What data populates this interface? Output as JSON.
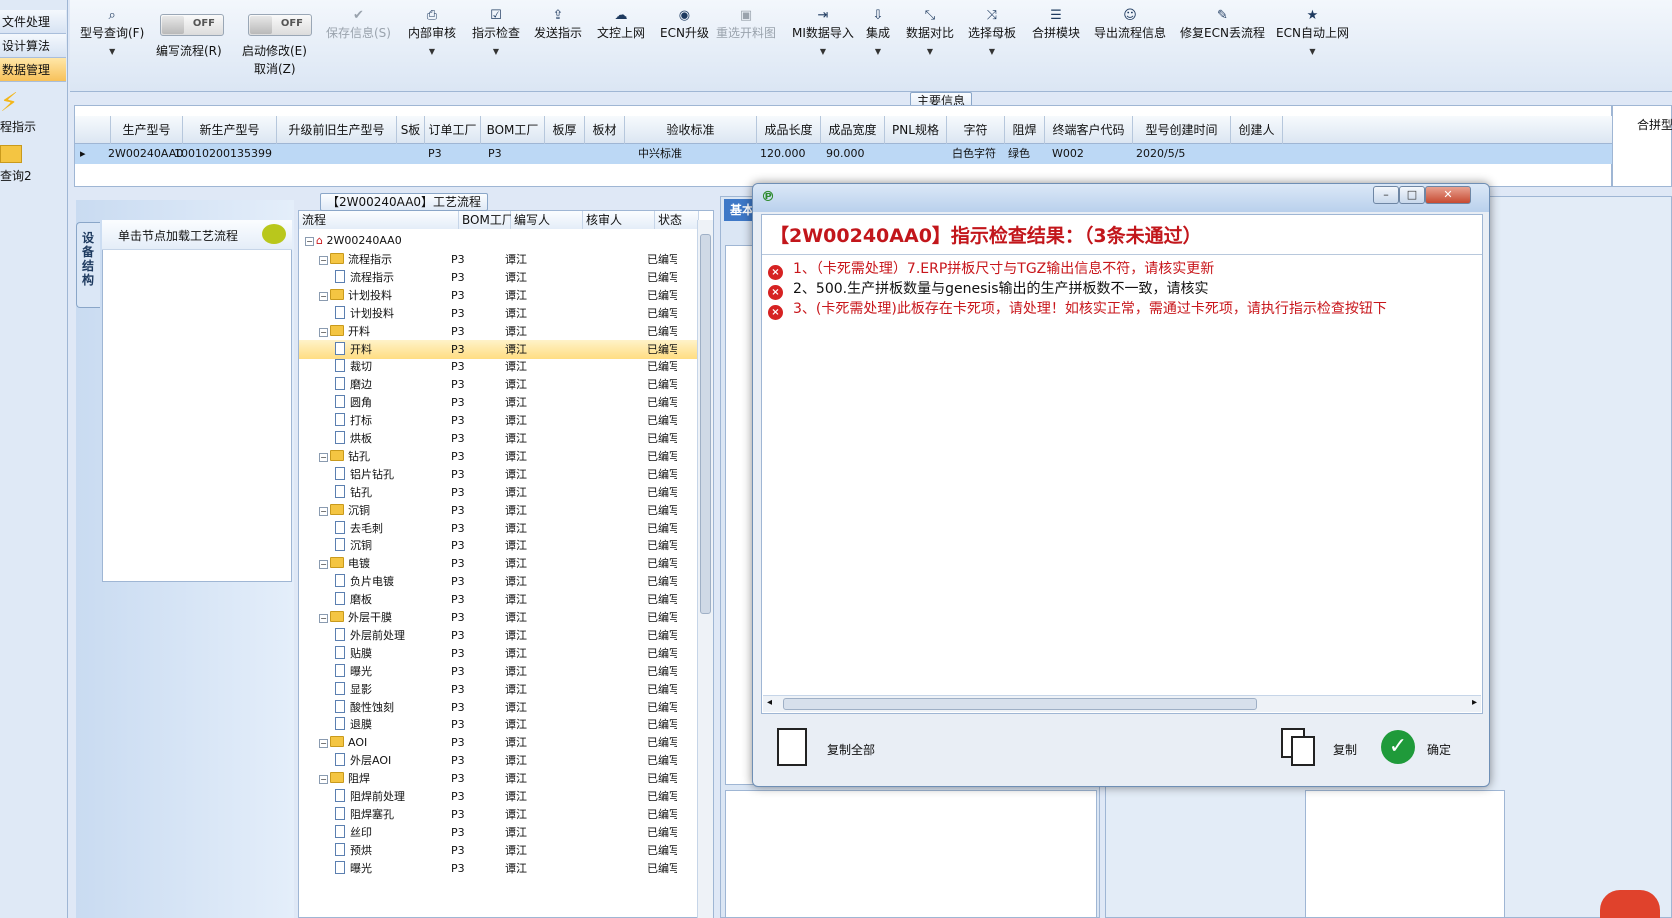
{
  "left_nav": {
    "items": [
      "文件处理",
      "设计算法",
      "数据管理"
    ],
    "big_items": [
      "程指示",
      "查询2"
    ]
  },
  "toolbar": {
    "buttons": [
      {
        "label": "型号查询(F)",
        "icon": "search-icon"
      },
      {
        "label": "保存信息(S)",
        "icon": "check-icon"
      },
      {
        "label": "内部审核",
        "icon": "printer-icon"
      },
      {
        "label": "指示检查",
        "icon": "checkbox-icon"
      },
      {
        "label": "发送指示",
        "icon": "upload-icon"
      },
      {
        "label": "文控上网",
        "icon": "cloud-upload-icon"
      },
      {
        "label": "ECN升级",
        "icon": "binoculars-icon"
      },
      {
        "label": "重选开料图",
        "icon": "image-icon"
      },
      {
        "label": "MI数据导入",
        "icon": "import-icon"
      },
      {
        "label": "集成",
        "icon": "download-icon"
      },
      {
        "label": "数据对比",
        "icon": "compress-icon"
      },
      {
        "label": "选择母板",
        "icon": "shuffle-icon"
      },
      {
        "label": "合拼模块",
        "icon": "list-icon"
      },
      {
        "label": "导出流程信息",
        "icon": "smile-icon"
      },
      {
        "label": "修复ECN丢流程",
        "icon": "wrench-icon"
      },
      {
        "label": "ECN自动上网",
        "icon": "star-icon"
      }
    ],
    "toggle1": {
      "state": "OFF",
      "label": "编写流程(R)"
    },
    "toggle2": {
      "state": "OFF",
      "label": "启动修改(E)",
      "label2": "取消(Z)"
    }
  },
  "main_info": {
    "title": "主要信息",
    "right_title": "合拼型",
    "columns": [
      "生产型号",
      "新生产型号",
      "升级前旧生产型号",
      "S板",
      "订单工厂",
      "BOM工厂",
      "板厚",
      "板材",
      "验收标准",
      "成品长度",
      "成品宽度",
      "PNL规格",
      "字符",
      "阻焊",
      "终端客户代码",
      "型号创建时间",
      "创建人"
    ],
    "row": [
      "2W00240AA0",
      "10010200135399",
      "",
      "",
      "P3",
      "P3",
      "",
      "",
      "中兴标准",
      "120.000",
      "90.000",
      "",
      "白色字符",
      "绿色",
      "W002",
      "2020/5/5",
      ""
    ]
  },
  "process": {
    "title": "【2W00240AA0】工艺流程",
    "side_tab": "设备结构",
    "hint": "单击节点加载工艺流程",
    "columns": [
      "流程",
      "BOM工厂",
      "编写人",
      "核审人",
      "状态"
    ],
    "root": "2W00240AA0",
    "factory": "P3",
    "writer": "谭江",
    "status": "已编写",
    "nodes": [
      {
        "name": "流程指示",
        "level": 1
      },
      {
        "name": "流程指示",
        "level": 2
      },
      {
        "name": "计划投料",
        "level": 1
      },
      {
        "name": "计划投料",
        "level": 2
      },
      {
        "name": "开料",
        "level": 1
      },
      {
        "name": "开料",
        "level": 2
      },
      {
        "name": "裁切",
        "level": 2
      },
      {
        "name": "磨边",
        "level": 2
      },
      {
        "name": "圆角",
        "level": 2
      },
      {
        "name": "打标",
        "level": 2
      },
      {
        "name": "烘板",
        "level": 2
      },
      {
        "name": "钻孔",
        "level": 1
      },
      {
        "name": "铝片钻孔",
        "level": 2
      },
      {
        "name": "钻孔",
        "level": 2
      },
      {
        "name": "沉铜",
        "level": 1
      },
      {
        "name": "去毛刺",
        "level": 2
      },
      {
        "name": "沉铜",
        "level": 2
      },
      {
        "name": "电镀",
        "level": 1
      },
      {
        "name": "负片电镀",
        "level": 2
      },
      {
        "name": "磨板",
        "level": 2
      },
      {
        "name": "外层干膜",
        "level": 1
      },
      {
        "name": "外层前处理",
        "level": 2
      },
      {
        "name": "贴膜",
        "level": 2
      },
      {
        "name": "曝光",
        "level": 2
      },
      {
        "name": "显影",
        "level": 2
      },
      {
        "name": "酸性蚀刻",
        "level": 2
      },
      {
        "name": "退膜",
        "level": 2
      },
      {
        "name": "AOI",
        "level": 1
      },
      {
        "name": "外层AOI",
        "level": 2
      },
      {
        "name": "阻焊",
        "level": 1
      },
      {
        "name": "阻焊前处理",
        "level": 2
      },
      {
        "name": "阻焊塞孔",
        "level": 2
      },
      {
        "name": "丝印",
        "level": 2
      },
      {
        "name": "预烘",
        "level": 2
      },
      {
        "name": "曝光",
        "level": 2
      }
    ]
  },
  "middle": {
    "tab": "基本"
  },
  "dialog": {
    "header": "【2W00240AA0】指示检查结果：（3条未通过）",
    "messages": [
      {
        "text": "1、（卡死需处理）7.ERP拼板尺寸与TGZ输出信息不符，请核实更新",
        "color": "#c8161b"
      },
      {
        "text": "2、500.生产拼板数量与genesis输出的生产拼板数不一致，请核实",
        "color": "#111111"
      },
      {
        "text": "3、(卡死需处理)此板存在卡死项，请处理！如核实正常，需通过卡死项，请执行指示检查按钮下",
        "color": "#c8161b"
      }
    ],
    "copy_all": "复制全部",
    "copy": "复制",
    "ok": "确定"
  }
}
